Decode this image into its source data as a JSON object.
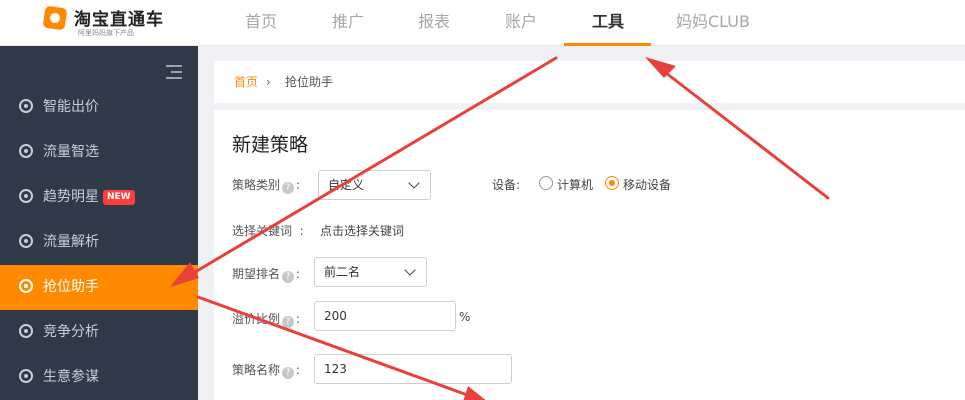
{
  "logo": {
    "title": "淘宝直通车",
    "subtitle": "阿里妈妈旗下产品"
  },
  "nav": {
    "items": [
      "首页",
      "推广",
      "报表",
      "账户",
      "工具",
      "妈妈CLUB"
    ],
    "active": "工具"
  },
  "sidebar": {
    "items": [
      {
        "label": "智能出价"
      },
      {
        "label": "流量智选"
      },
      {
        "label": "趋势明星",
        "badge": "NEW"
      },
      {
        "label": "流量解析"
      },
      {
        "label": "抢位助手",
        "active": true
      },
      {
        "label": "竞争分析"
      },
      {
        "label": "生意参谋"
      }
    ]
  },
  "breadcrumb": {
    "home": "首页",
    "separator": "›",
    "current": "抢位助手"
  },
  "form": {
    "title": "新建策略",
    "strategy_type_label": "策略类别",
    "strategy_type_value": "自定义",
    "device_label": "设备:",
    "device_options": [
      "计算机",
      "移动设备"
    ],
    "device_selected": "移动设备",
    "keyword_label": "选择关键词",
    "keyword_colon": ":",
    "keyword_action": "点击选择关键词",
    "rank_label": "期望排名",
    "rank_value": "前二名",
    "premium_label": "溢价比例",
    "premium_value": "200",
    "premium_unit": "%",
    "name_label": "策略名称",
    "name_value": "123",
    "colon": ":"
  },
  "colors": {
    "accent": "#ff8a00",
    "sidebar_bg": "#2f3948",
    "arrow": "#e8413b"
  }
}
